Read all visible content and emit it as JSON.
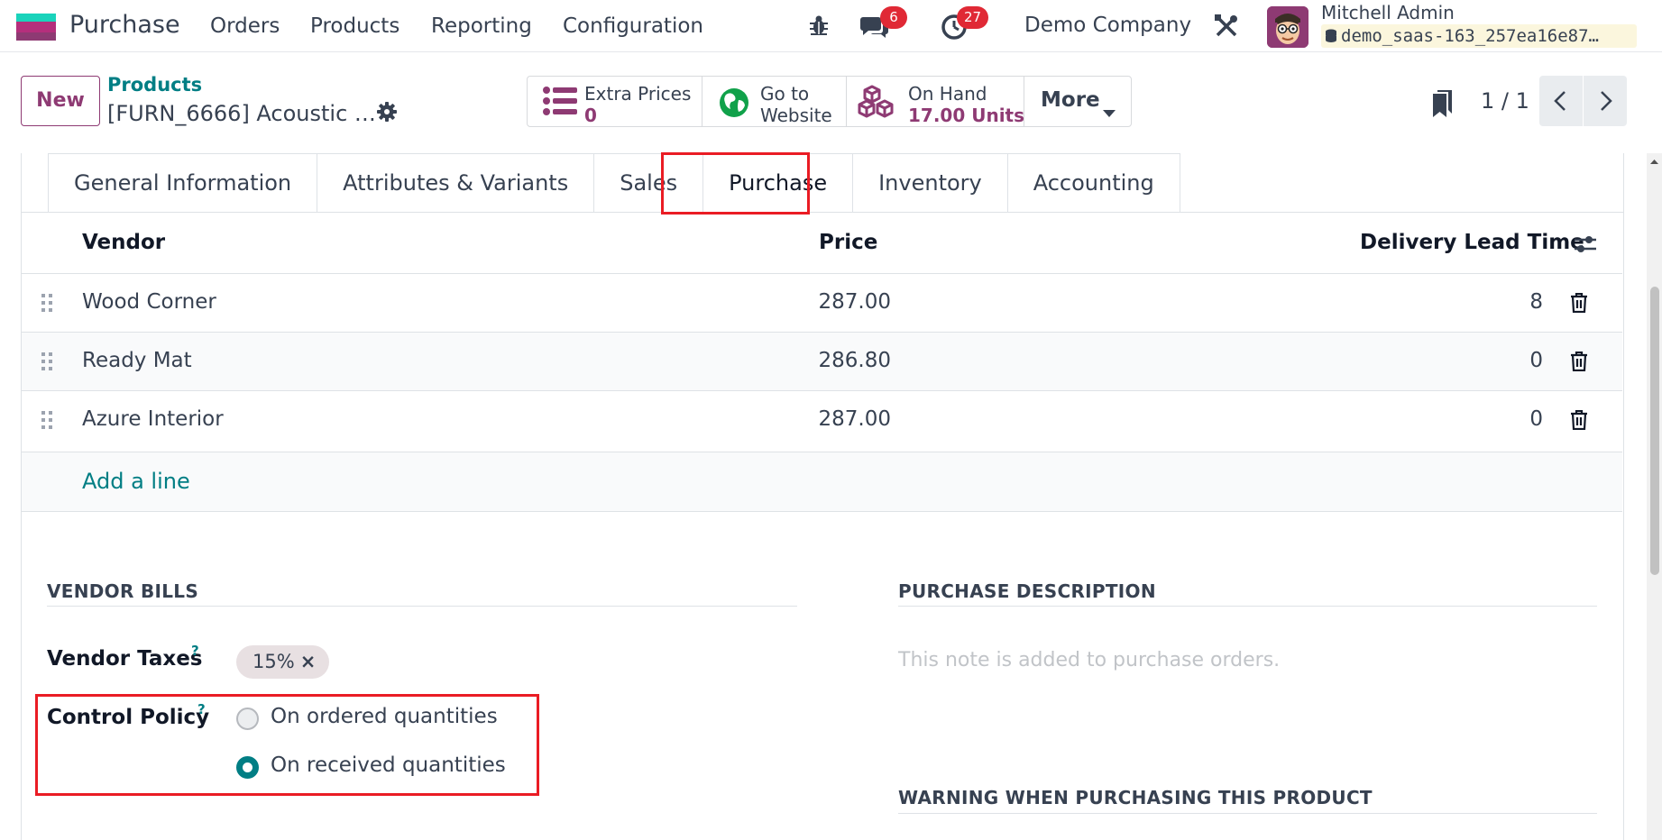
{
  "navbar": {
    "app_name": "Purchase",
    "menu": [
      "Orders",
      "Products",
      "Reporting",
      "Configuration"
    ],
    "messages_count": "6",
    "activities_count": "27",
    "company": "Demo Company",
    "user_name": "Mitchell Admin",
    "database": "demo_saas-163_257ea16e87…"
  },
  "control_panel": {
    "new_label": "New",
    "breadcrumb_parent": "Products",
    "breadcrumb_current": "[FURN_6666] Acoustic …",
    "smart_buttons": {
      "extra_prices_label": "Extra Prices",
      "extra_prices_value": "0",
      "website_line1": "Go to",
      "website_line2": "Website",
      "on_hand_label": "On Hand",
      "on_hand_value": "17.00 Units",
      "more_label": "More"
    },
    "pager": "1 / 1"
  },
  "tabs": [
    "General Information",
    "Attributes & Variants",
    "Sales",
    "Purchase",
    "Inventory",
    "Accounting"
  ],
  "vendor_table": {
    "columns": [
      "Vendor",
      "Price",
      "Delivery Lead Time"
    ],
    "rows": [
      {
        "vendor": "Wood Corner",
        "price": "287.00",
        "lead_time": "8"
      },
      {
        "vendor": "Ready Mat",
        "price": "286.80",
        "lead_time": "0"
      },
      {
        "vendor": "Azure Interior",
        "price": "287.00",
        "lead_time": "0"
      }
    ],
    "add_line": "Add a line"
  },
  "vendor_bills": {
    "title": "VENDOR BILLS",
    "vendor_taxes_label": "Vendor Taxes",
    "vendor_taxes_tag": "15%",
    "control_policy_label": "Control Policy",
    "help_mark": "?",
    "policy_options": [
      "On ordered quantities",
      "On received quantities"
    ],
    "policy_selected": "On received quantities"
  },
  "purchase_description": {
    "title": "PURCHASE DESCRIPTION",
    "placeholder": "This note is added to purchase orders."
  },
  "warning_section": {
    "title": "WARNING WHEN PURCHASING THIS PRODUCT"
  },
  "colors": {
    "brand": "#8e3a73",
    "link": "#017e84",
    "badge": "#e02935",
    "highlight": "#ea1c24"
  }
}
